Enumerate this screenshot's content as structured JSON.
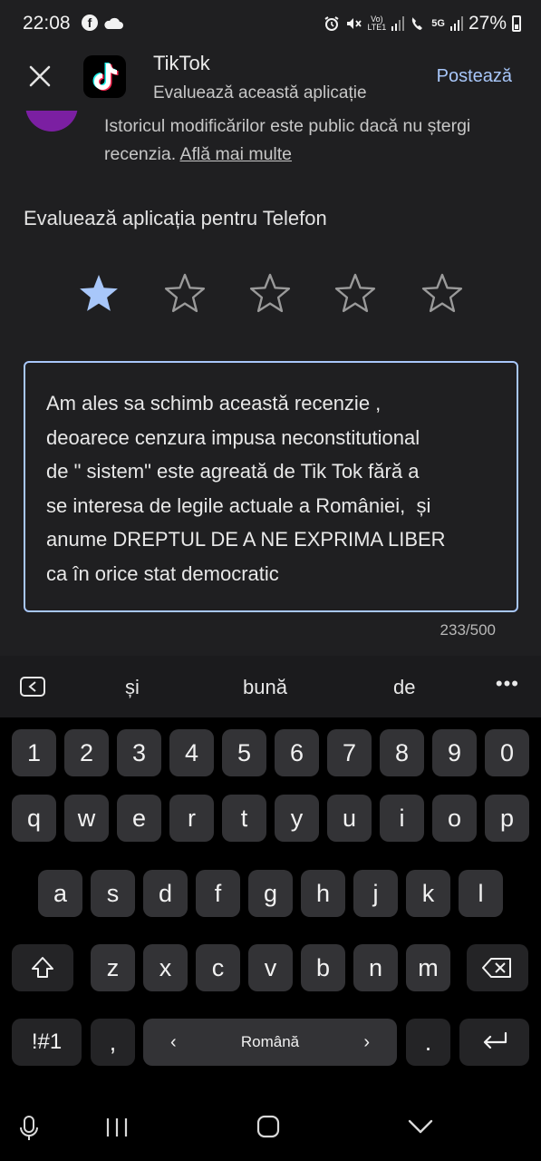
{
  "status_bar": {
    "time": "22:08",
    "net_label_top": "Vo)",
    "net_label_bottom": "LTE1",
    "signal_5g_label": "5G",
    "battery_percent": "27%"
  },
  "header": {
    "app_name": "TikTok",
    "subtitle": "Evaluează această aplicație",
    "post_label": "Postează"
  },
  "history_note": {
    "text": "Istoricul modificărilor este public dacă nu ștergi recenzia. ",
    "link": "Află mai multe"
  },
  "rating": {
    "title": "Evaluează aplicația pentru Telefon",
    "value": 1,
    "max": 5,
    "filled_color": "#a8c7fa",
    "empty_color": "#9a9a9a"
  },
  "review": {
    "lines": [
      "Am ales sa schimb această recenzie ,",
      "deoarece cenzura impusa neconstitutional",
      "de \" sistem\" este agreată de Tik Tok fără a",
      "se interesa de legile actuale a României,  și",
      "anume DREPTUL DE A NE EXPRIMA LIBER",
      "ca în orice stat democratic"
    ],
    "counter": "233/500"
  },
  "keyboard": {
    "suggestions": [
      "și",
      "bună",
      "de"
    ],
    "row_numbers": [
      "1",
      "2",
      "3",
      "4",
      "5",
      "6",
      "7",
      "8",
      "9",
      "0"
    ],
    "row_1": [
      "q",
      "w",
      "e",
      "r",
      "t",
      "y",
      "u",
      "i",
      "o",
      "p"
    ],
    "row_2": [
      "a",
      "s",
      "d",
      "f",
      "g",
      "h",
      "j",
      "k",
      "l"
    ],
    "row_3": [
      "z",
      "x",
      "c",
      "v",
      "b",
      "n",
      "m"
    ],
    "symbols_label": "!#1",
    "comma_label": ",",
    "language_label": "Română",
    "period_label": "."
  },
  "colors": {
    "accent": "#a8c7fa",
    "background": "#1f1f21",
    "avatar": "#7b1fa2"
  }
}
